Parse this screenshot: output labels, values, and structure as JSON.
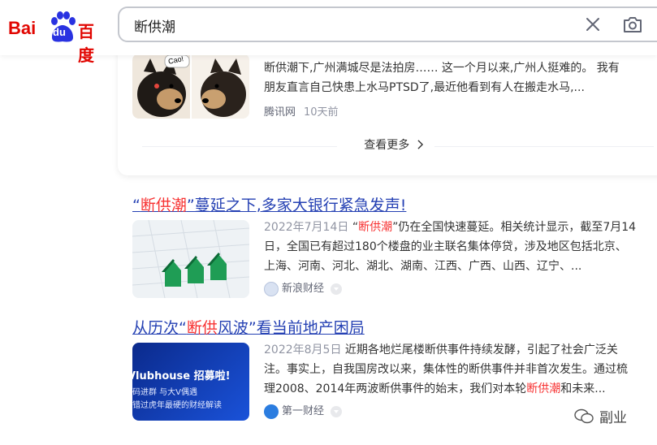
{
  "header": {
    "logo_bai": "Bai",
    "logo_du": "du",
    "logo_cn": "百度",
    "search_value": "断供潮"
  },
  "card": {
    "snippet_line1": "断供潮下,广州满城尽是法拍房…… 这一个月以来,广州人挺难的。 我有",
    "snippet_line2": "朋友直言自己快患上水马PTSD了,最近他看到有人在搬走水马,...",
    "source": "腾讯网",
    "time": "10天前",
    "thumb_text": "Cao!",
    "more_label": "查看更多"
  },
  "results": [
    {
      "title_pre": "“",
      "title_hl": "断供潮",
      "title_post": "”蔓延之下,多家大银行紧急发声!",
      "date": "2022年7月14日",
      "snippet_pre": "“",
      "snippet_hl": "断供潮",
      "snippet_l1_post": "”仍在全国快速蔓延。相关统计显示，截至7月14",
      "snippet_l2": "日，全国已有超过180个楼盘的业主联名集体停贷，涉及地区包括北京、",
      "snippet_l3": "上海、河南、河北、湖北、湖南、江西、广西、山西、辽宁、...",
      "source": "新浪财经"
    },
    {
      "title_pre": "从历次“",
      "title_hl": "断供",
      "title_post": "风波”看当前地产困局",
      "date": "2022年8月5日",
      "snippet_l1": "近期各地烂尾楼断供事件持续发酵，引起了社会广泛关",
      "snippet_l2": "注。事实上，自我国房改以来，集体性的断供事件并非首次发生。通过梳",
      "snippet_l3_pre": "理2008、2014年两波断供事件的始末，我们对本轮",
      "snippet_l3_hl": "断供潮",
      "snippet_l3_post": "和未来...",
      "source": "第一财经",
      "thumb_title": "Vlubhouse 招募啦!",
      "thumb_sub1": "码进群 与大V偶遇",
      "thumb_sub2": "错过虎年最硬的财经解读"
    }
  ],
  "watermark": "副业",
  "colors": {
    "brand_red": "#e10601",
    "link_blue": "#2440b3",
    "highlight_red": "#f73131",
    "meta_gray": "#9195a3"
  }
}
